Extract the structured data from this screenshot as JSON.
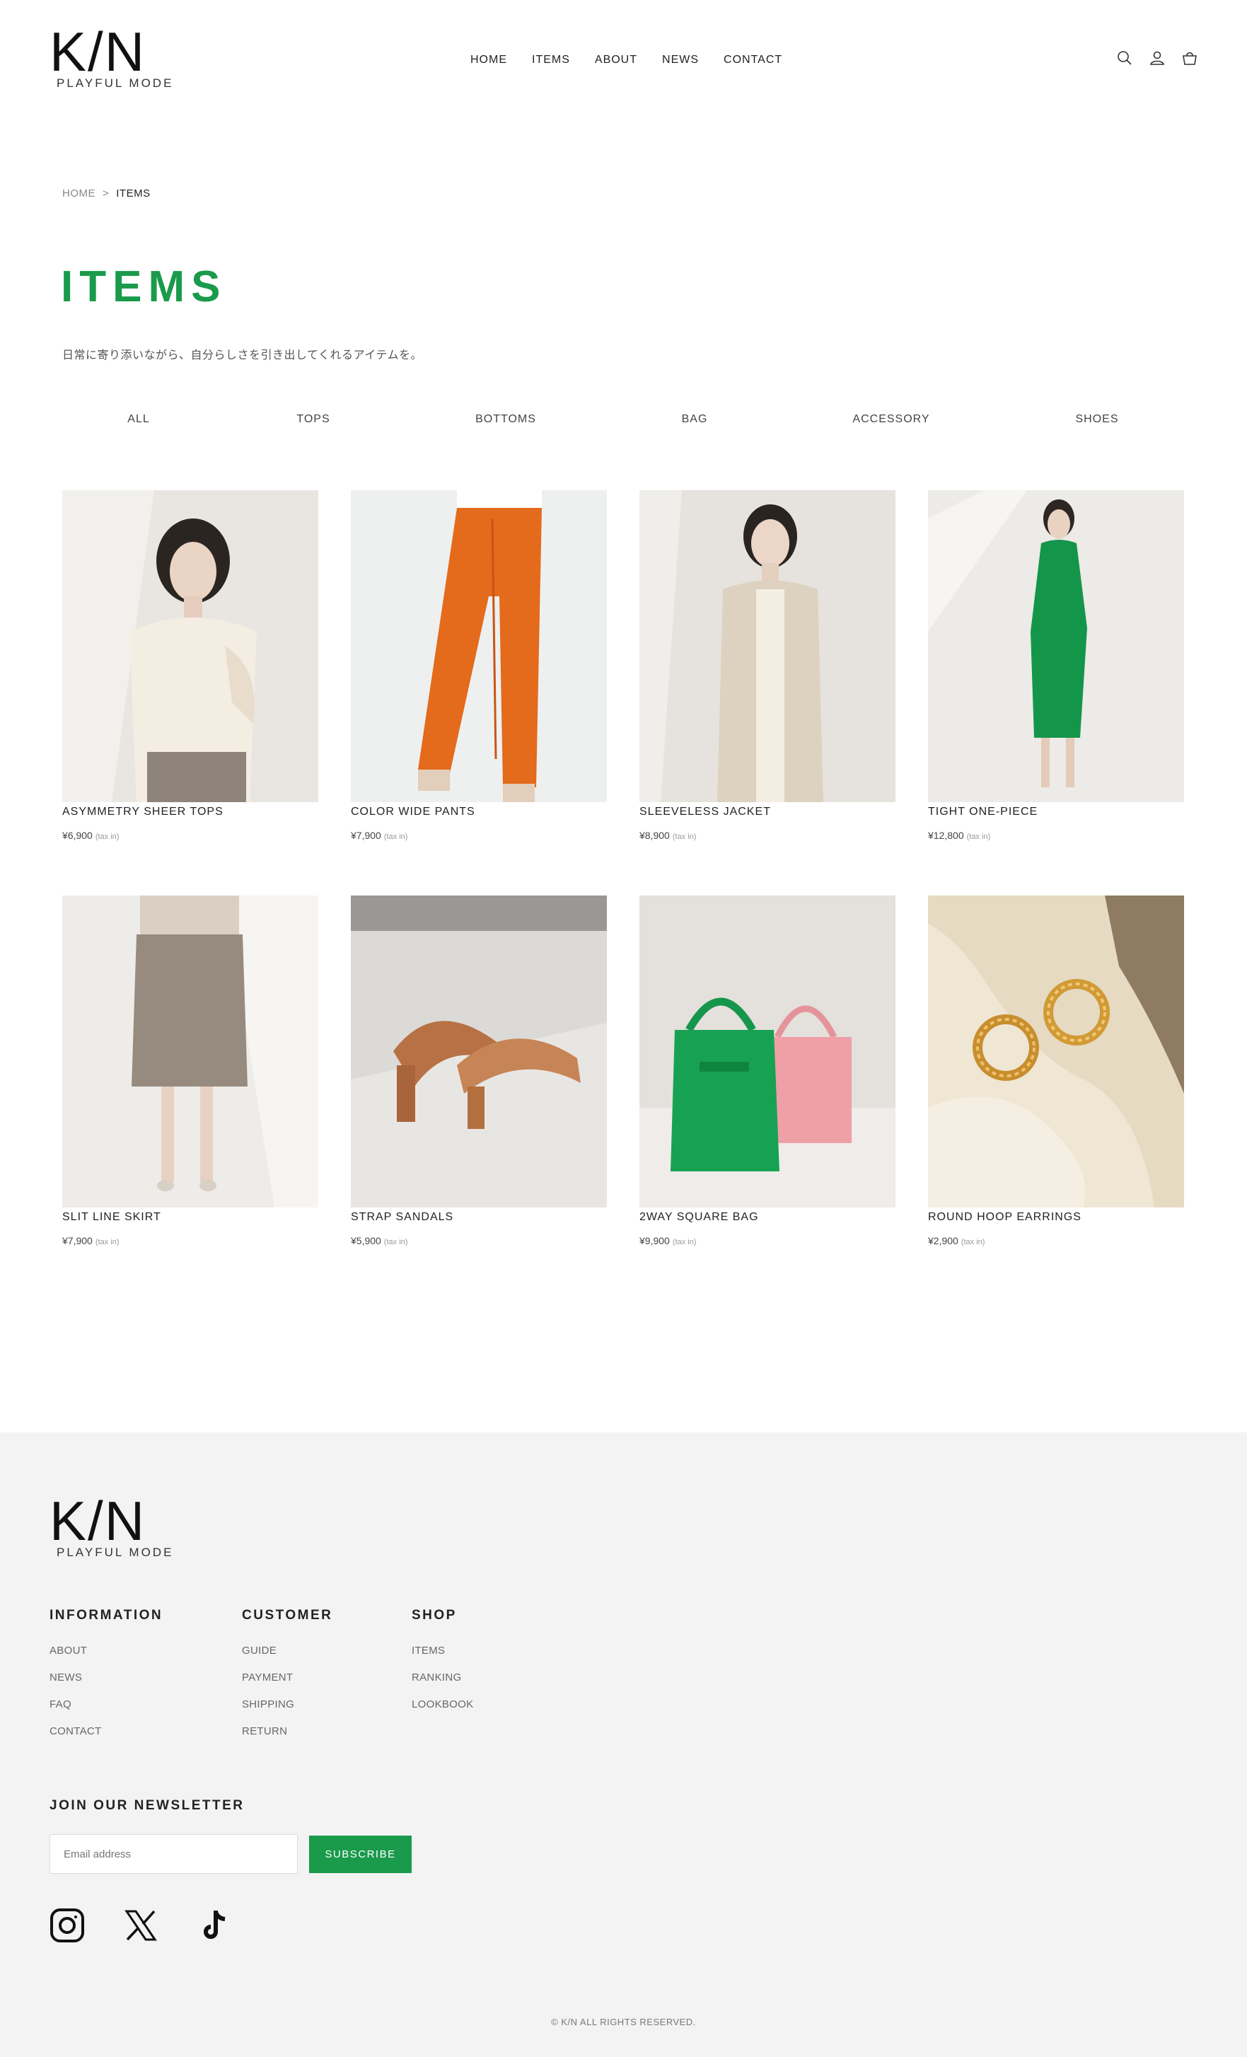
{
  "brand": {
    "mark": "K/N",
    "sub": "PLAYFUL MODE"
  },
  "nav": [
    "HOME",
    "ITEMS",
    "ABOUT",
    "NEWS",
    "CONTACT"
  ],
  "header_icons": [
    "search-icon",
    "user-icon",
    "cart-icon"
  ],
  "breadcrumb": {
    "home": "HOME",
    "sep": ">",
    "current": "ITEMS"
  },
  "page": {
    "title": "ITEMS",
    "lead": "日常に寄り添いながら、自分らしさを引き出してくれるアイテムを。"
  },
  "categories": [
    "ALL",
    "TOPS",
    "BOTTOMS",
    "BAG",
    "ACCESSORY",
    "SHOES"
  ],
  "colors": {
    "accent": "#1a9a4b",
    "footer_bg": "#f3f3f3"
  },
  "products": [
    {
      "name": "ASYMMETRY SHEER TOPS",
      "price": "¥6,900",
      "tax": "(tax in)"
    },
    {
      "name": "COLOR WIDE PANTS",
      "price": "¥7,900",
      "tax": "(tax in)"
    },
    {
      "name": "SLEEVELESS JACKET",
      "price": "¥8,900",
      "tax": "(tax in)"
    },
    {
      "name": "TIGHT ONE-PIECE",
      "price": "¥12,800",
      "tax": "(tax in)"
    },
    {
      "name": "SLIT LINE SKIRT",
      "price": "¥7,900",
      "tax": "(tax in)"
    },
    {
      "name": "STRAP SANDALS",
      "price": "¥5,900",
      "tax": "(tax in)"
    },
    {
      "name": "2WAY SQUARE BAG",
      "price": "¥9,900",
      "tax": "(tax in)"
    },
    {
      "name": "ROUND HOOP EARRINGS",
      "price": "¥2,900",
      "tax": "(tax in)"
    }
  ],
  "footer": {
    "columns": [
      {
        "title": "INFORMATION",
        "links": [
          "ABOUT",
          "NEWS",
          "FAQ",
          "CONTACT"
        ]
      },
      {
        "title": "CUSTOMER",
        "links": [
          "GUIDE",
          "PAYMENT",
          "SHIPPING",
          "RETURN"
        ]
      },
      {
        "title": "SHOP",
        "links": [
          "ITEMS",
          "RANKING",
          "LOOKBOOK"
        ]
      }
    ],
    "newsletter": {
      "title": "JOIN OUR NEWSLETTER",
      "placeholder": "Email address",
      "button": "SUBSCRIBE"
    },
    "social": [
      "instagram-icon",
      "x-icon",
      "tiktok-icon"
    ],
    "copyright": "© K/N ALL RIGHTS RESERVED."
  }
}
